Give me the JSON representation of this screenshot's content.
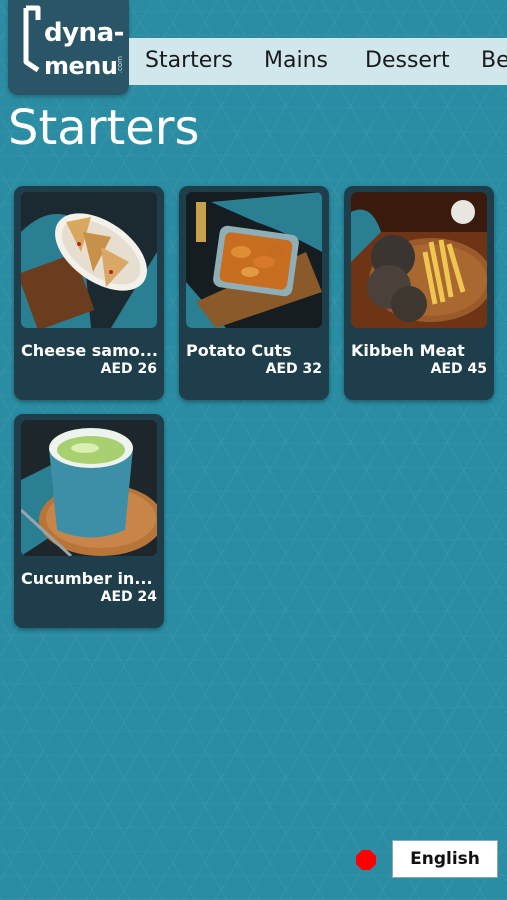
{
  "brand": {
    "line1": "dyna-",
    "line2": "menu",
    "suffix": ".com"
  },
  "tabs": [
    {
      "label": "Starters"
    },
    {
      "label": "Mains"
    },
    {
      "label": "Dessert"
    },
    {
      "label": "Be"
    }
  ],
  "page_title": "Starters",
  "items": [
    {
      "name": "Cheese samo...",
      "price": "AED 26",
      "image": "cheese-samosa-photo"
    },
    {
      "name": "Potato Cuts",
      "price": "AED 32",
      "image": "potato-cuts-photo"
    },
    {
      "name": "Kibbeh Meat",
      "price": "AED 45",
      "image": "kibbeh-meat-photo"
    },
    {
      "name": "Cucumber in...",
      "price": "AED 24",
      "image": "cucumber-salad-photo"
    }
  ],
  "language": {
    "label": "English",
    "indicator_color": "#ff0000"
  },
  "colors": {
    "background": "#2b8da3",
    "card": "#1f3e4b",
    "tabbar": "#d2e7ec",
    "logo_bg": "#2a5566"
  }
}
